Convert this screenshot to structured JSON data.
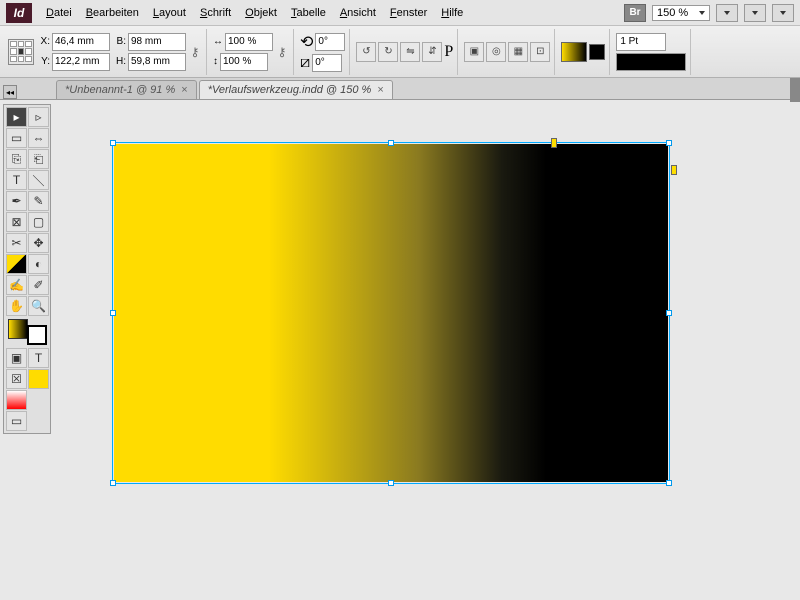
{
  "app": {
    "logo": "Id",
    "bridge": "Br"
  },
  "menu": {
    "items": [
      {
        "key": "D",
        "rest": "atei"
      },
      {
        "key": "B",
        "rest": "earbeiten"
      },
      {
        "key": "L",
        "rest": "ayout"
      },
      {
        "key": "S",
        "rest": "chrift"
      },
      {
        "key": "O",
        "rest": "bjekt"
      },
      {
        "key": "T",
        "rest": "abelle"
      },
      {
        "key": "A",
        "rest": "nsicht"
      },
      {
        "key": "F",
        "rest": "enster"
      },
      {
        "key": "H",
        "rest": "ilfe"
      }
    ],
    "zoom": "150 %"
  },
  "control": {
    "x": "46,4 mm",
    "y": "122,2 mm",
    "w": "98 mm",
    "h": "59,8 mm",
    "sx": "100 %",
    "sy": "100 %",
    "rotate": "0°",
    "shear": "0°",
    "stroke_weight": "1 Pt",
    "p_glyph": "P"
  },
  "tabs": [
    {
      "title": "*Unbenannt-1 @ 91 %",
      "active": false
    },
    {
      "title": "*Verlaufswerkzeug.indd @ 150 %",
      "active": true
    }
  ],
  "tools": {
    "row_labels": [
      "select",
      "direct-select",
      "page",
      "gap",
      "content-collector",
      "content-placer",
      "type",
      "line",
      "pen",
      "pencil",
      "frame",
      "rect",
      "scissors",
      "free-transform",
      "gradient-swatch",
      "gradient-feather",
      "note",
      "eyedropper",
      "hand",
      "zoom"
    ]
  }
}
